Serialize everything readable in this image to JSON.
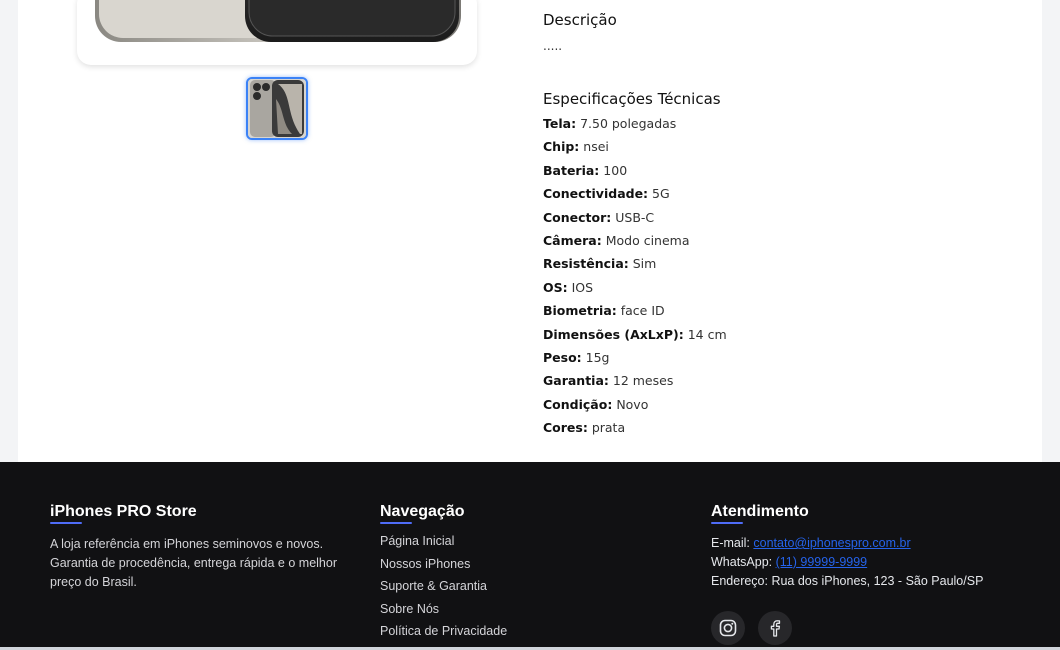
{
  "product": {
    "main_image_alt": "iPhone",
    "thumbnail_alt": "iPhone thumbnail"
  },
  "description": {
    "title": "Descrição",
    "text": "....."
  },
  "specs": {
    "title": "Especificações Técnicas",
    "items": [
      {
        "label": "Tela:",
        "value": "7.50 polegadas"
      },
      {
        "label": "Chip:",
        "value": "nsei"
      },
      {
        "label": "Bateria:",
        "value": "100"
      },
      {
        "label": "Conectividade:",
        "value": "5G"
      },
      {
        "label": "Conector:",
        "value": "USB-C"
      },
      {
        "label": "Câmera:",
        "value": "Modo cinema"
      },
      {
        "label": "Resistência:",
        "value": "Sim"
      },
      {
        "label": "OS:",
        "value": "IOS"
      },
      {
        "label": "Biometria:",
        "value": "face ID"
      },
      {
        "label": "Dimensões (AxLxP):",
        "value": "14 cm"
      },
      {
        "label": "Peso:",
        "value": "15g"
      },
      {
        "label": "Garantia:",
        "value": "12 meses"
      },
      {
        "label": "Condição:",
        "value": "Novo"
      },
      {
        "label": "Cores:",
        "value": "prata"
      }
    ]
  },
  "footer": {
    "brand": {
      "title": "iPhones PRO Store",
      "text": "A loja referência em iPhones seminovos e novos. Garantia de procedência, entrega rápida e o melhor preço do Brasil."
    },
    "nav": {
      "title": "Navegação",
      "items": [
        "Página Inicial",
        "Nossos iPhones",
        "Suporte & Garantia",
        "Sobre Nós",
        "Política de Privacidade"
      ]
    },
    "support": {
      "title": "Atendimento",
      "email_label": "E-mail:",
      "email": "contato@iphonespro.com.br",
      "whatsapp_label": "WhatsApp:",
      "whatsapp": "(11) 99999-9999",
      "address": "Endereço: Rua dos iPhones, 123 - São Paulo/SP"
    },
    "social": [
      "instagram-icon",
      "facebook-icon"
    ],
    "accent_color": "#4f6cf7"
  }
}
